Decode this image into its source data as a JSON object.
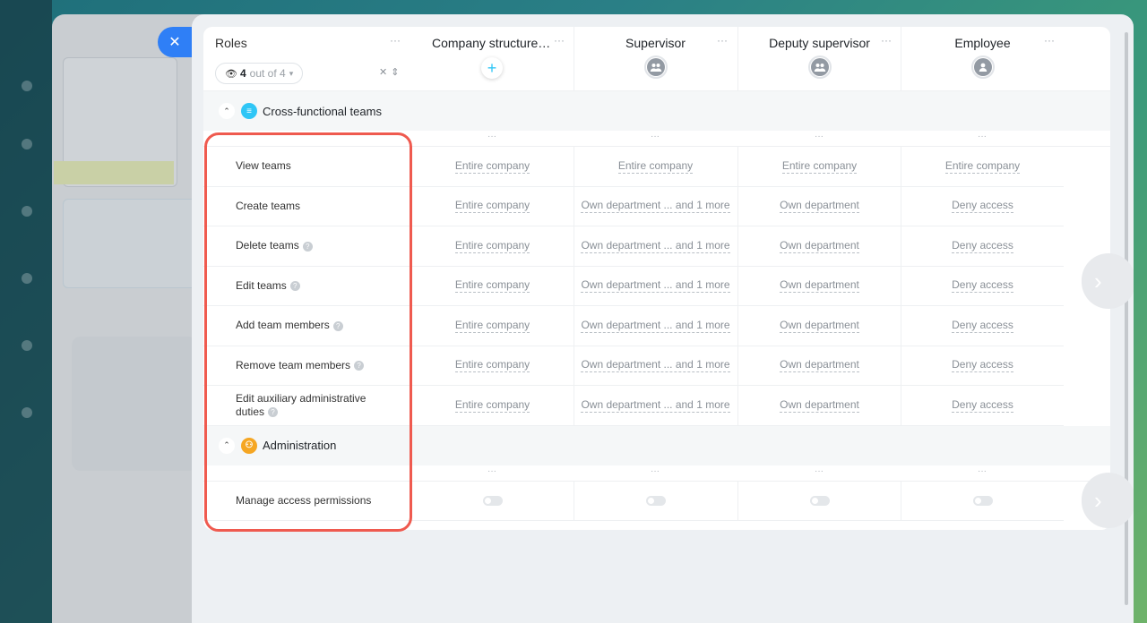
{
  "close_icon": "close-icon",
  "header": {
    "roles_title": "Roles",
    "count": {
      "value": "4",
      "suffix": "out of 4"
    },
    "columns": [
      {
        "title": "Company structure a...",
        "kind": "add"
      },
      {
        "title": "Supervisor",
        "kind": "group-avatar"
      },
      {
        "title": "Deputy supervisor",
        "kind": "group-avatar"
      },
      {
        "title": "Employee",
        "kind": "user-avatar"
      }
    ]
  },
  "sections": [
    {
      "label": "Cross-functional teams",
      "icon_color": "#2fc6f6",
      "rows": [
        {
          "label": "View teams",
          "help": false,
          "values": [
            "Entire company",
            "Entire company",
            "Entire company",
            "Entire company"
          ]
        },
        {
          "label": "Create teams",
          "help": false,
          "values": [
            "Entire company",
            "Own department ... and 1 more",
            "Own department",
            "Deny access"
          ]
        },
        {
          "label": "Delete teams",
          "help": true,
          "values": [
            "Entire company",
            "Own department ... and 1 more",
            "Own department",
            "Deny access"
          ]
        },
        {
          "label": "Edit teams",
          "help": true,
          "values": [
            "Entire company",
            "Own department ... and 1 more",
            "Own department",
            "Deny access"
          ]
        },
        {
          "label": "Add team members",
          "help": true,
          "values": [
            "Entire company",
            "Own department ... and 1 more",
            "Own department",
            "Deny access"
          ]
        },
        {
          "label": "Remove team members",
          "help": true,
          "values": [
            "Entire company",
            "Own department ... and 1 more",
            "Own department",
            "Deny access"
          ]
        },
        {
          "label": "Edit auxiliary administrative duties",
          "help": true,
          "values": [
            "Entire company",
            "Own department ... and 1 more",
            "Own department",
            "Deny access"
          ]
        }
      ]
    },
    {
      "label": "Administration",
      "icon_color": "#f5a623",
      "rows": [
        {
          "label": "Manage access permissions",
          "help": false,
          "toggles": [
            false,
            false,
            false,
            false
          ]
        }
      ]
    }
  ],
  "colors": {
    "accent": "#2f7ff6",
    "highlight": "#ef5a4f"
  }
}
